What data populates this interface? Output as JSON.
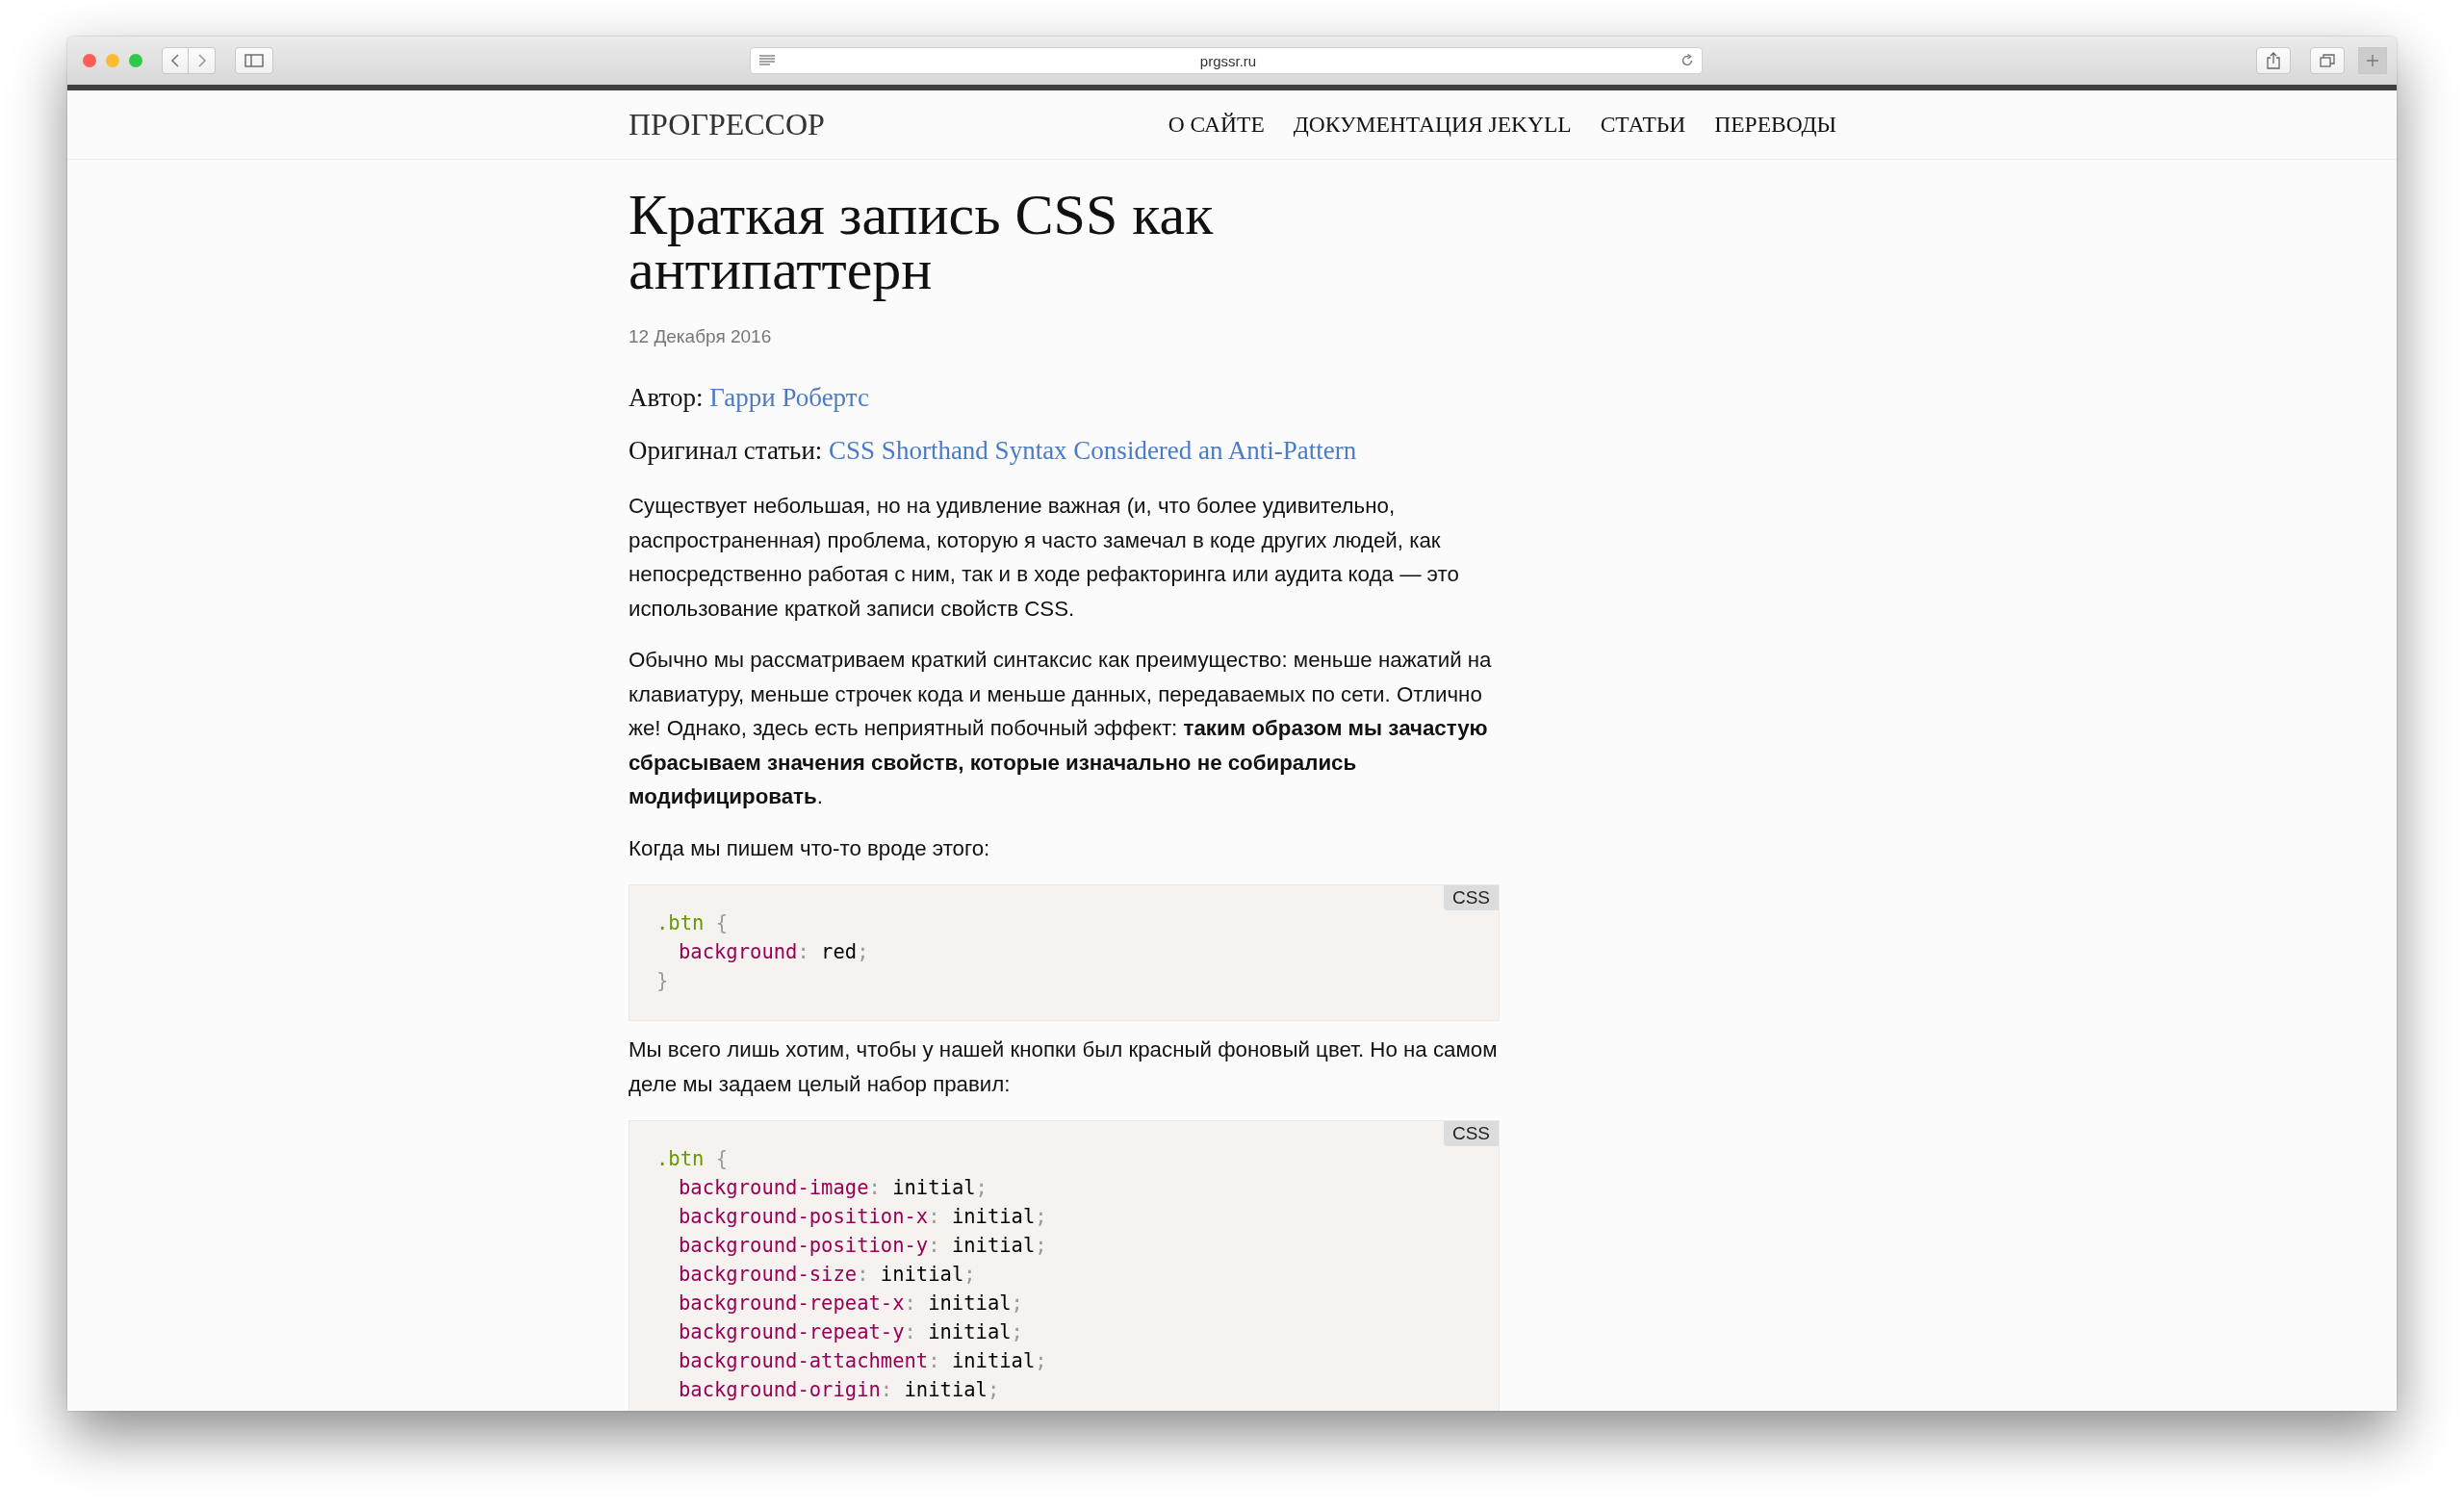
{
  "browser": {
    "url": "prgssr.ru"
  },
  "site": {
    "logo": "ПРОГРЕССОР",
    "nav": [
      {
        "label": "О САЙТЕ"
      },
      {
        "label": "ДОКУМЕНТАЦИЯ JEKYLL"
      },
      {
        "label": "СТАТЬИ"
      },
      {
        "label": "ПЕРЕВОДЫ"
      }
    ]
  },
  "article": {
    "title": "Краткая запись CSS как антипаттерн",
    "date": "12 Декабря 2016",
    "meta": [
      {
        "label": "Автор:",
        "link": "Гарри Робертс"
      },
      {
        "label": "Оригинал статьи:",
        "link": "CSS Shorthand Syntax Considered an Anti-Pattern"
      }
    ],
    "blocks": [
      {
        "kind": "paragraph",
        "text": "Существует небольшая, но на удивление важная (и, что более удивительно, распространенная) проблема, которую я часто замечал в коде других людей, как непосредственно работая с ним, так и в ходе рефакторинга или аудита кода — это использование краткой записи свойств CSS."
      },
      {
        "kind": "paragraph",
        "text": "Обычно мы рассматриваем краткий синтаксис как преимущество: меньше нажатий на клавиатуру, меньше строчек кода и меньше данных, передаваемых по сети. Отлично же! Однако, здесь есть неприятный побочный эффект: **таким образом мы зачастую сбрасываем значения свойств, которые изначально не собирались модифицировать**."
      },
      {
        "kind": "paragraph",
        "text": "Когда мы пишем что-то вроде этого:"
      },
      {
        "kind": "code",
        "language": "CSS",
        "lines": [
          {
            "indented": false,
            "tokens": [
              {
                "kind": "selector",
                "text": ".btn"
              },
              {
                "kind": "punct",
                "text": " {"
              }
            ]
          },
          {
            "indented": true,
            "tokens": [
              {
                "kind": "property",
                "text": "background"
              },
              {
                "kind": "punct",
                "text": ": "
              },
              {
                "kind": "value",
                "text": "red"
              },
              {
                "kind": "punct",
                "text": ";"
              }
            ]
          },
          {
            "indented": false,
            "tokens": [
              {
                "kind": "punct",
                "text": "}"
              }
            ]
          }
        ]
      },
      {
        "kind": "paragraph",
        "text": "Мы всего лишь хотим, чтобы у нашей кнопки был красный фоновый цвет. Но на самом деле мы задаем целый набор правил:"
      },
      {
        "kind": "code",
        "language": "CSS",
        "lines": [
          {
            "indented": false,
            "tokens": [
              {
                "kind": "selector",
                "text": ".btn"
              },
              {
                "kind": "punct",
                "text": " {"
              }
            ]
          },
          {
            "indented": true,
            "tokens": [
              {
                "kind": "property",
                "text": "background-image"
              },
              {
                "kind": "punct",
                "text": ": "
              },
              {
                "kind": "value",
                "text": "initial"
              },
              {
                "kind": "punct",
                "text": ";"
              }
            ]
          },
          {
            "indented": true,
            "tokens": [
              {
                "kind": "property",
                "text": "background-position-x"
              },
              {
                "kind": "punct",
                "text": ": "
              },
              {
                "kind": "value",
                "text": "initial"
              },
              {
                "kind": "punct",
                "text": ";"
              }
            ]
          },
          {
            "indented": true,
            "tokens": [
              {
                "kind": "property",
                "text": "background-position-y"
              },
              {
                "kind": "punct",
                "text": ": "
              },
              {
                "kind": "value",
                "text": "initial"
              },
              {
                "kind": "punct",
                "text": ";"
              }
            ]
          },
          {
            "indented": true,
            "tokens": [
              {
                "kind": "property",
                "text": "background-size"
              },
              {
                "kind": "punct",
                "text": ": "
              },
              {
                "kind": "value",
                "text": "initial"
              },
              {
                "kind": "punct",
                "text": ";"
              }
            ]
          },
          {
            "indented": true,
            "tokens": [
              {
                "kind": "property",
                "text": "background-repeat-x"
              },
              {
                "kind": "punct",
                "text": ": "
              },
              {
                "kind": "value",
                "text": "initial"
              },
              {
                "kind": "punct",
                "text": ";"
              }
            ]
          },
          {
            "indented": true,
            "tokens": [
              {
                "kind": "property",
                "text": "background-repeat-y"
              },
              {
                "kind": "punct",
                "text": ": "
              },
              {
                "kind": "value",
                "text": "initial"
              },
              {
                "kind": "punct",
                "text": ";"
              }
            ]
          },
          {
            "indented": true,
            "tokens": [
              {
                "kind": "property",
                "text": "background-attachment"
              },
              {
                "kind": "punct",
                "text": ": "
              },
              {
                "kind": "value",
                "text": "initial"
              },
              {
                "kind": "punct",
                "text": ";"
              }
            ]
          },
          {
            "indented": true,
            "tokens": [
              {
                "kind": "property",
                "text": "background-origin"
              },
              {
                "kind": "punct",
                "text": ": "
              },
              {
                "kind": "value",
                "text": "initial"
              },
              {
                "kind": "punct",
                "text": ";"
              }
            ]
          }
        ]
      }
    ]
  }
}
